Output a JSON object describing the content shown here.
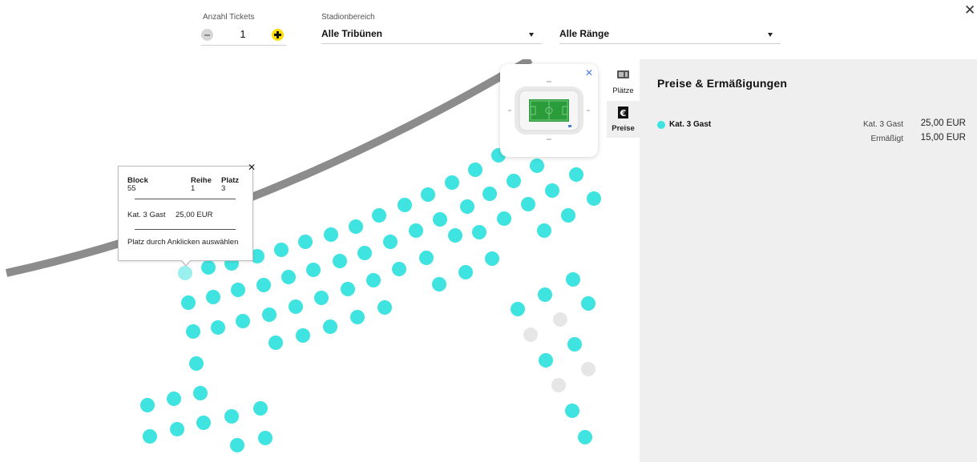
{
  "filters": {
    "tickets_label": "Anzahl Tickets",
    "tickets_value": "1",
    "area_label": "Stadionbereich",
    "area_value": "Alle Tribünen",
    "rank_value": "Alle Ränge"
  },
  "popup": {
    "block_label": "Block",
    "block_value": "55",
    "row_label": "Reihe",
    "row_value": "1",
    "seat_label": "Platz",
    "seat_value": "3",
    "category": "Kat. 3 Gast",
    "price": "25,00 EUR",
    "hint": "Platz durch Anklicken auswählen"
  },
  "tabs": {
    "seats_label": "Plätze",
    "prices_label": "Preise"
  },
  "prices_panel": {
    "title": "Preise & Ermäßigungen",
    "category_name": "Kat. 3 Gast",
    "rows": [
      {
        "label": "Kat. 3 Gast",
        "price": "25,00 EUR"
      },
      {
        "label": "Ermäßigt",
        "price": "15,00 EUR"
      }
    ]
  },
  "colors": {
    "seat_available": "#3fe3e0",
    "seat_selected": "#9af0ee",
    "seat_unavailable": "#e6e6e6",
    "accent_yellow": "#ffdd00",
    "panel_bg": "#efefef"
  },
  "icons": [
    "minus-icon",
    "plus-icon",
    "chevron-down-icon",
    "close-icon",
    "ticket-icon",
    "euro-icon",
    "fit-to-screen-icon",
    "zoom-in-icon",
    "zoom-out-icon",
    "stadium-minimap-icon"
  ]
}
